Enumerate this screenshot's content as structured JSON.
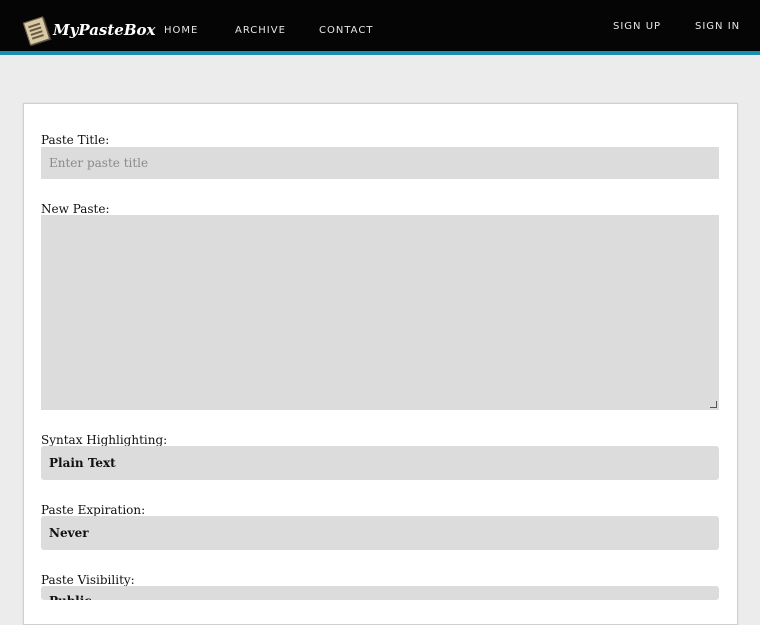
{
  "header": {
    "brand": "MyPasteBox",
    "nav": [
      {
        "label": "HOME"
      },
      {
        "label": "ARCHIVE"
      },
      {
        "label": "CONTACT"
      }
    ],
    "auth": [
      {
        "label": "SIGN UP"
      },
      {
        "label": "SIGN IN"
      }
    ],
    "accent_color": "#1a8fb5"
  },
  "form": {
    "title_label": "Paste Title:",
    "title_placeholder": "Enter paste title",
    "paste_label": "New Paste:",
    "syntax_label": "Syntax Highlighting:",
    "syntax_value": "Plain Text",
    "expiration_label": "Paste Expiration:",
    "expiration_value": "Never",
    "visibility_label": "Paste Visibility:",
    "visibility_value": "Public"
  }
}
